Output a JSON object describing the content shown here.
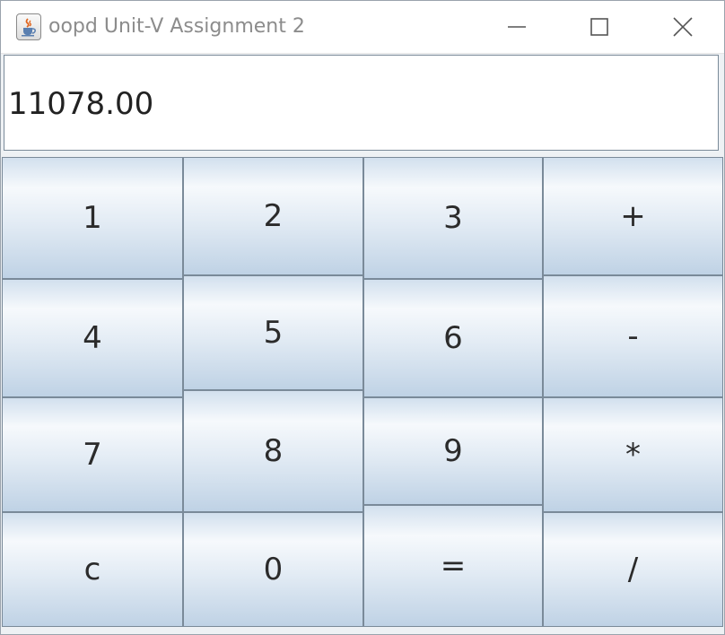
{
  "window": {
    "title": "oopd Unit-V Assignment 2",
    "icon": "java-cup-icon",
    "controls": [
      "minimize-icon",
      "maximize-icon",
      "close-icon"
    ]
  },
  "display": {
    "value": "11078.00"
  },
  "keys": [
    "1",
    "2",
    "3",
    "+",
    "4",
    "5",
    "6",
    "-",
    "7",
    "8",
    "9",
    "*",
    "c",
    "0",
    "=",
    "/"
  ],
  "colors": {
    "key_gradient_top": "#d2e0ee",
    "key_gradient_highlight": "#f6f9fc",
    "key_gradient_bottom": "#bfd2e5",
    "key_border": "#7a8a99",
    "title_text": "#8c8c8c"
  }
}
